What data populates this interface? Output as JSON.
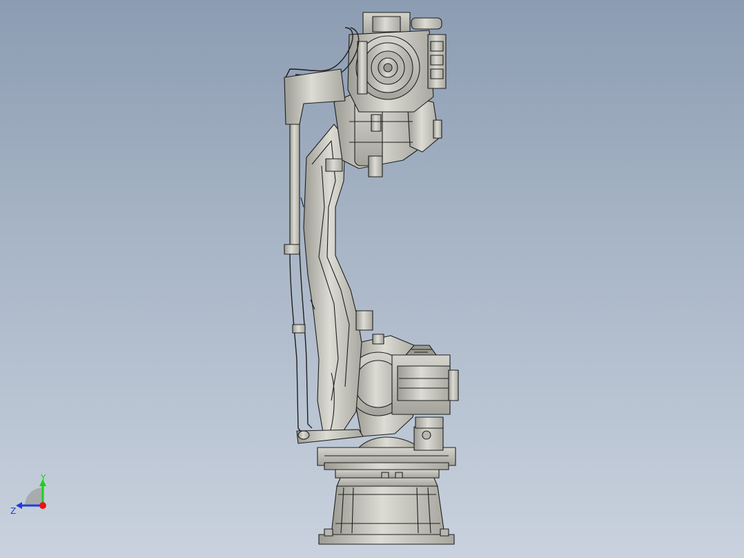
{
  "viewport": {
    "background_top": "#8c9cb2",
    "background_bottom": "#c9d2de",
    "model_fill": "#c9c9c1",
    "model_shade": "#9e9e96",
    "model_edge": "#1e1e1e"
  },
  "triad": {
    "y_label": "Y",
    "z_label": "Z",
    "y_color": "#19d219",
    "z_color": "#1e3cdc",
    "x_color": "#e81515"
  }
}
